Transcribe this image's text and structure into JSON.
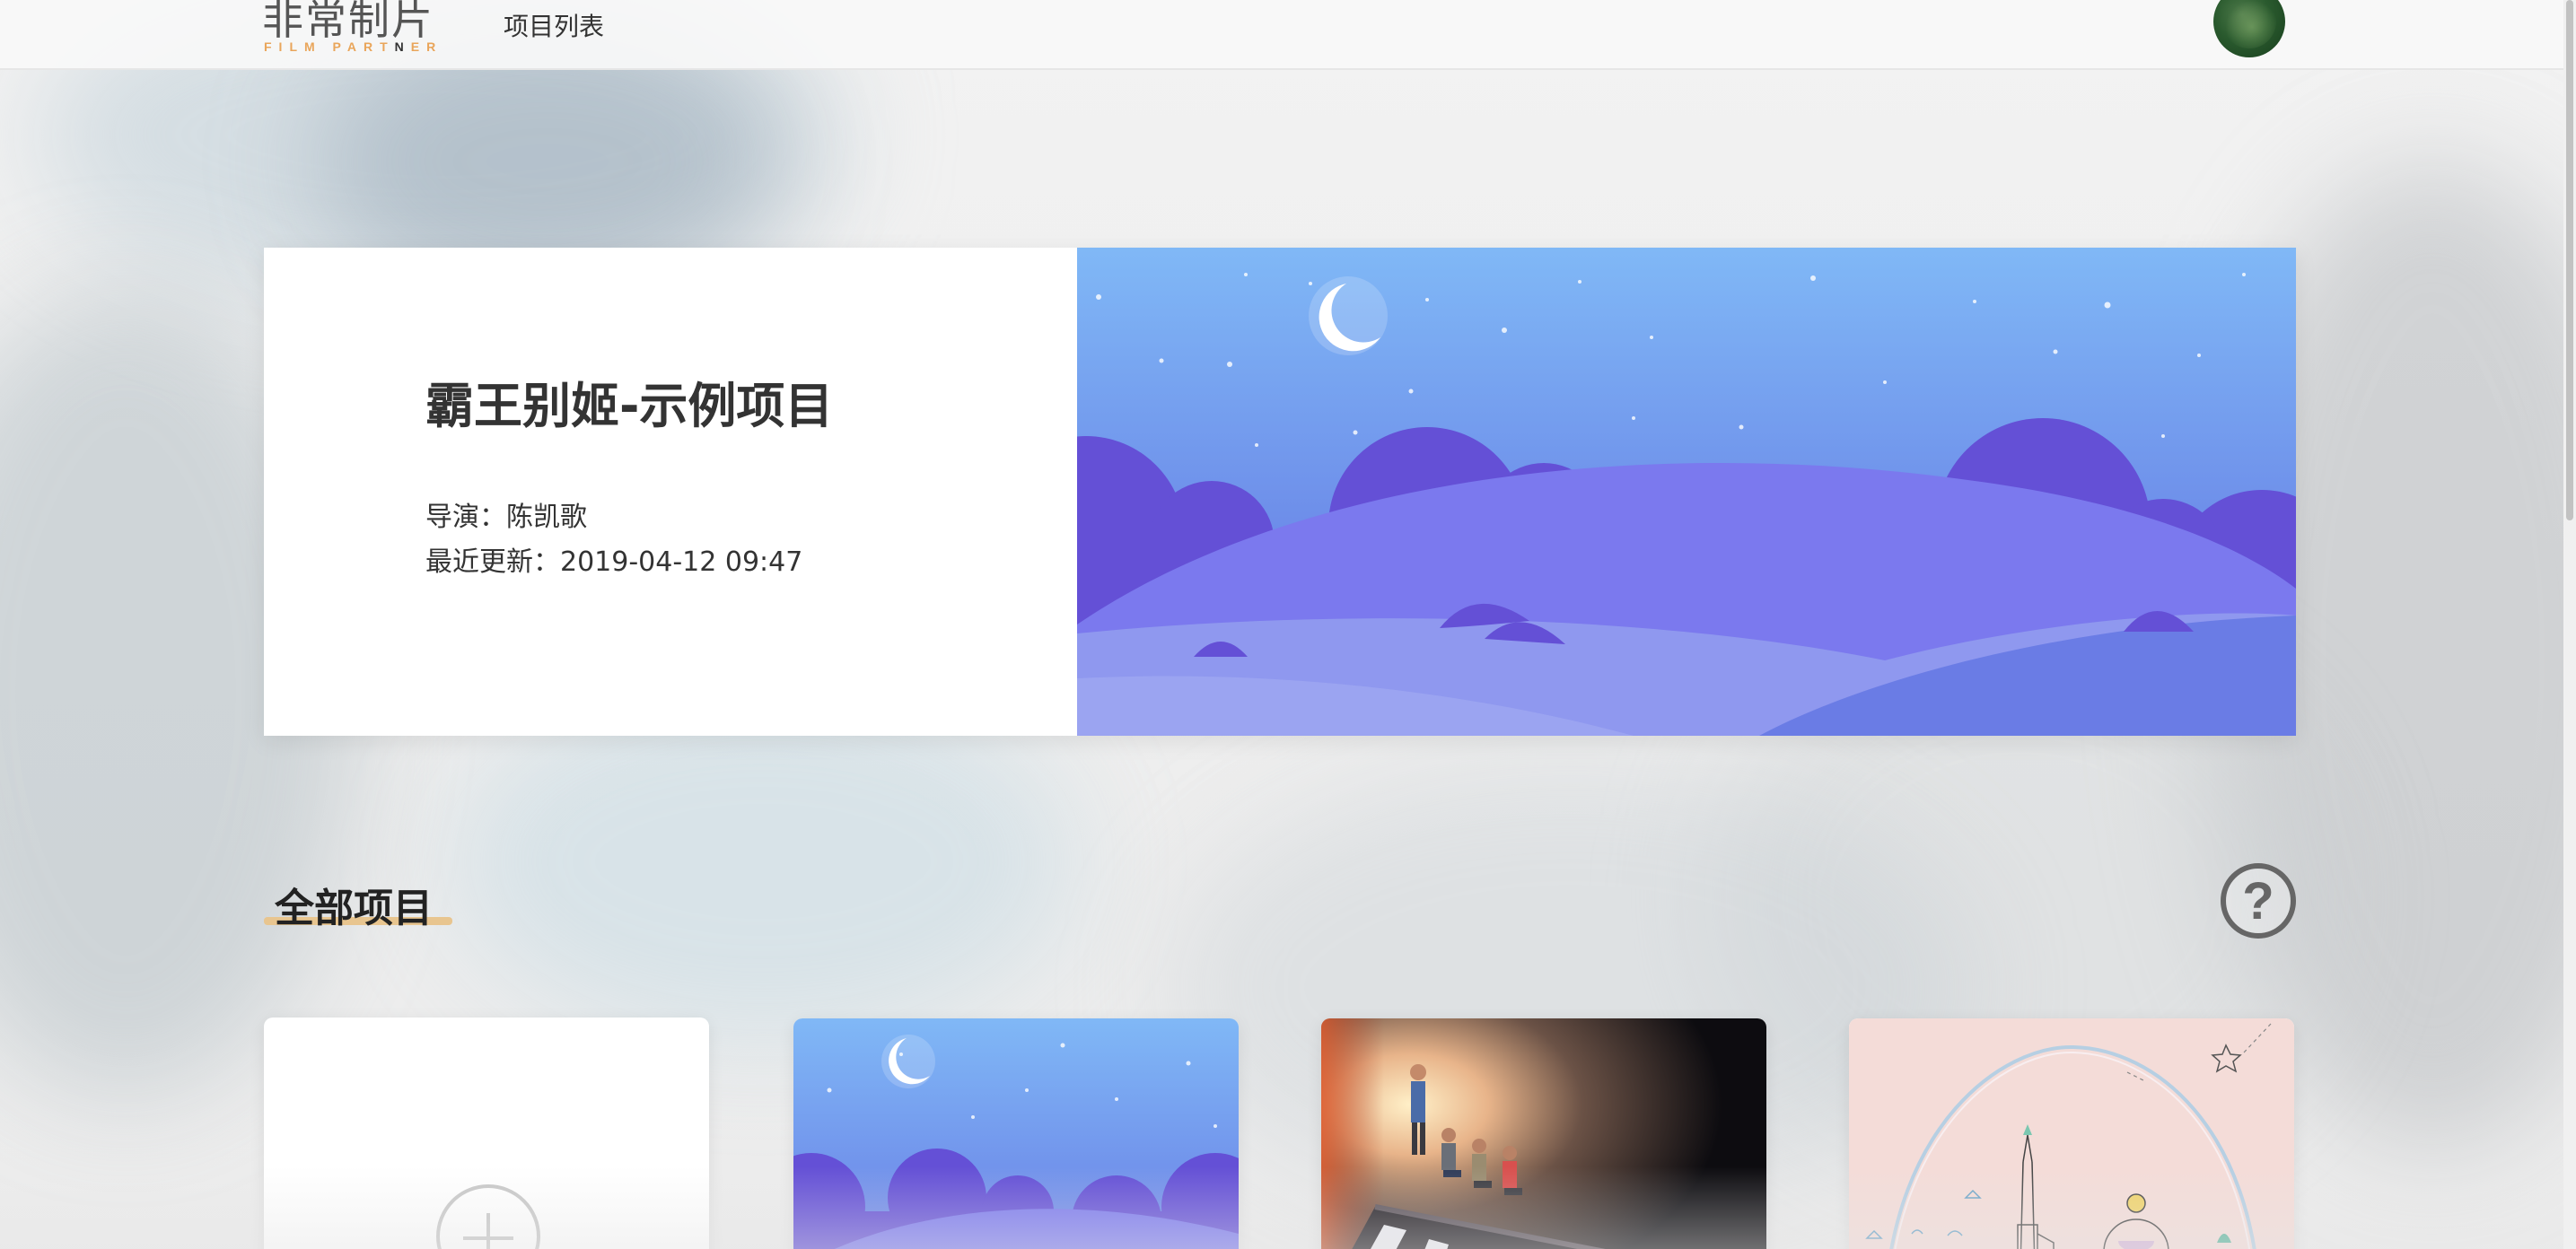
{
  "header": {
    "logo_cn": "非常制片",
    "logo_en_prefix": "FILM PART",
    "logo_en_highlight": "N",
    "logo_en_suffix": "ER",
    "nav_projects": "项目列表"
  },
  "featured": {
    "title": "霸王别姬-示例项目",
    "director_label": "导演：",
    "director": "陈凯歌",
    "updated_label": "最近更新：",
    "updated": "2019-04-12 09:47"
  },
  "section": {
    "title": "全部项目",
    "help_symbol": "?"
  },
  "colors": {
    "accent_underline": "#e8c58f",
    "logo_orange": "#e9a55a",
    "night_sky_top": "#7fb6f5",
    "night_sky_bottom": "#6470e0"
  },
  "icons": {
    "new_project": "plus-circle-icon",
    "help": "question-circle-icon"
  }
}
